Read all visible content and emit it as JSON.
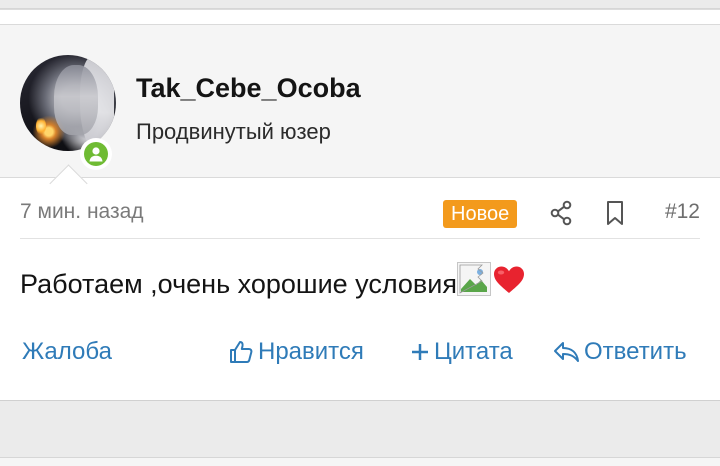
{
  "user": {
    "name": "Tak_Cebe_Ocoba",
    "title": "Продвинутый юзер",
    "avatar_icon": "user-avatar-photo",
    "status_icon": "online-user-icon",
    "status_color": "#6fbb33"
  },
  "post": {
    "time": "7 мин. назад",
    "badge": "Новое",
    "badge_color": "#f39a1c",
    "number": "#12",
    "text": "Работаем ,очень хорошие условия",
    "emoji": "❤️"
  },
  "actions": {
    "report": "Жалоба",
    "like": "Нравится",
    "quote": "Цитата",
    "reply": "Ответить",
    "link_color": "#2f7bb8"
  }
}
